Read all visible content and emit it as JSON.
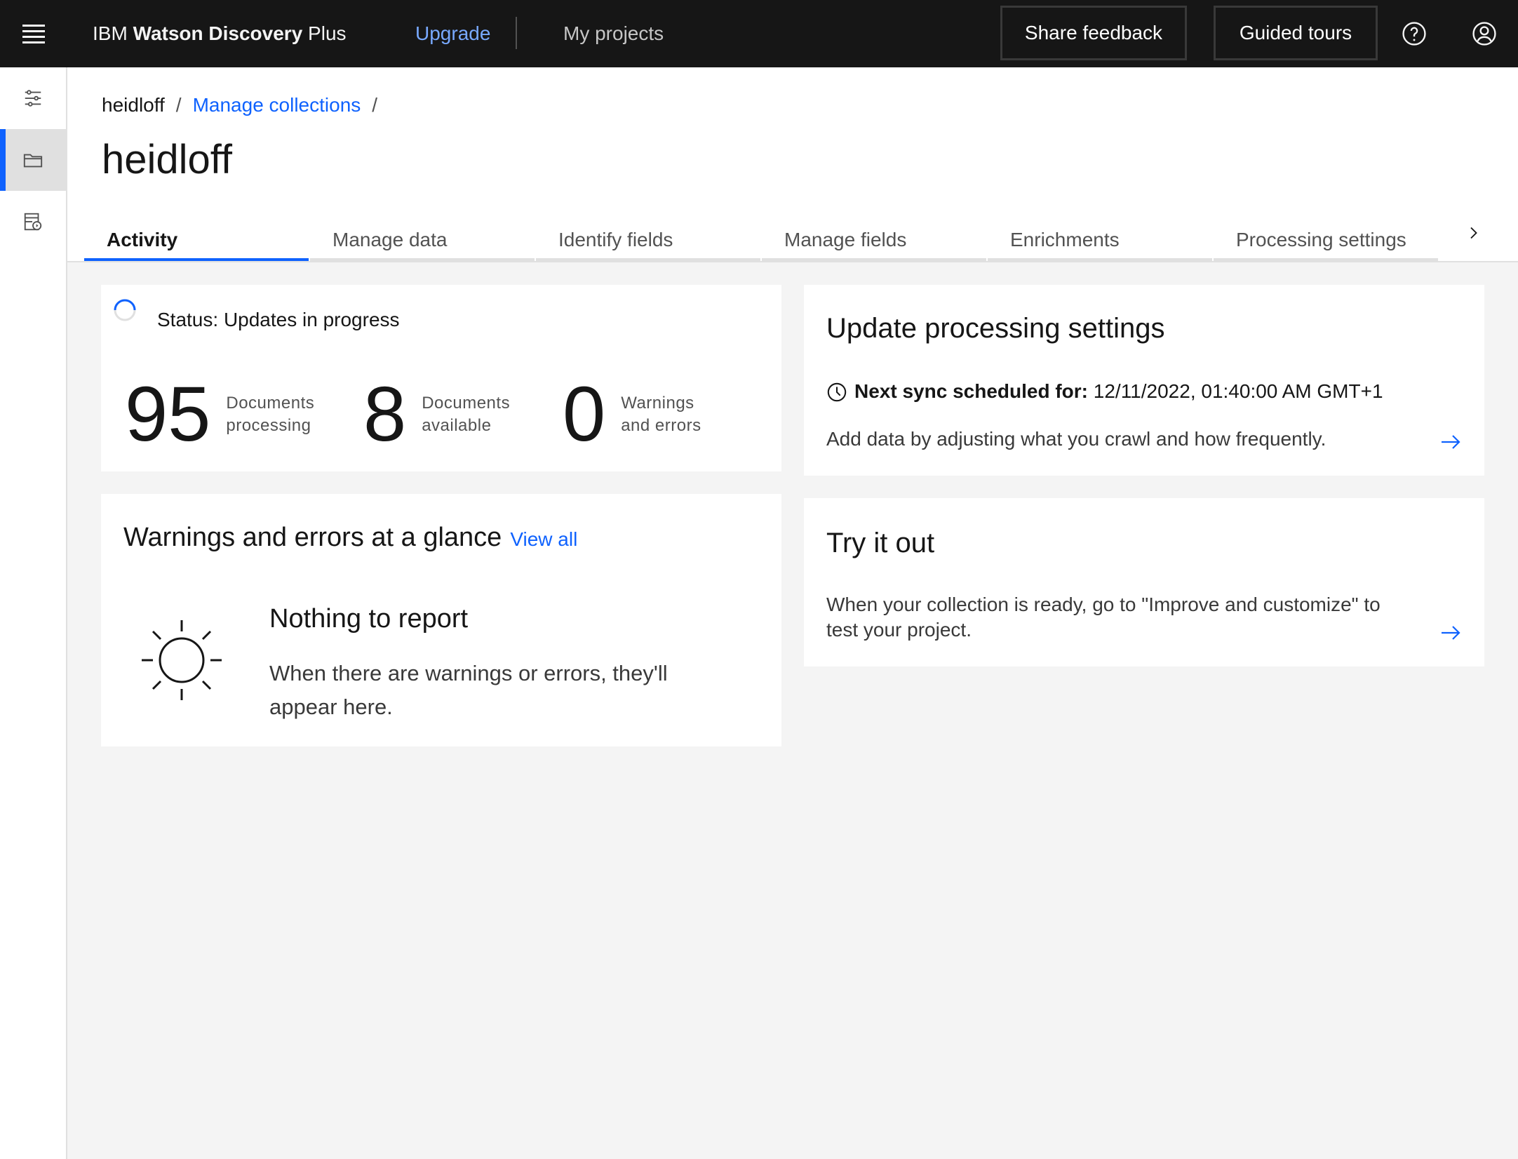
{
  "header": {
    "brand_prefix": "IBM ",
    "brand_bold": "Watson Discovery",
    "brand_suffix": " Plus",
    "upgrade": "Upgrade",
    "my_projects": "My projects",
    "share_feedback": "Share feedback",
    "guided_tours": "Guided tours",
    "icons": [
      "menu-icon",
      "help-icon",
      "user-avatar-icon"
    ]
  },
  "rail": {
    "items": [
      {
        "icon": "settings-adjust-icon",
        "active": false
      },
      {
        "icon": "folder-icon",
        "active": true
      },
      {
        "icon": "data-view-icon",
        "active": false
      }
    ]
  },
  "breadcrumb": {
    "items": [
      "heidloff",
      "Manage collections"
    ],
    "separator": "/"
  },
  "page_title": "heidloff",
  "tabs": [
    {
      "label": "Activity",
      "active": true
    },
    {
      "label": "Manage data",
      "active": false
    },
    {
      "label": "Identify fields",
      "active": false
    },
    {
      "label": "Manage fields",
      "active": false
    },
    {
      "label": "Enrichments",
      "active": false
    },
    {
      "label": "Processing settings",
      "active": false
    }
  ],
  "status": {
    "text": "Status: Updates in progress",
    "metrics": [
      {
        "value": "95",
        "label1": "Documents",
        "label2": "processing"
      },
      {
        "value": "8",
        "label1": "Documents",
        "label2": "available"
      },
      {
        "value": "0",
        "label1": "Warnings",
        "label2": "and errors"
      }
    ]
  },
  "warnings": {
    "title": "Warnings and errors at a glance",
    "view_all": "View all",
    "empty_title": "Nothing to report",
    "empty_body": "When there are warnings or errors, they'll appear here."
  },
  "update": {
    "title": "Update processing settings",
    "sync_label": "Next sync scheduled for:",
    "sync_value": " 12/11/2022, 01:40:00 AM GMT+1",
    "body": "Add data by adjusting what you crawl and how frequently."
  },
  "try_it": {
    "title": "Try it out",
    "body": "When your collection is ready, go to \"Improve and customize\" to test your project."
  },
  "colors": {
    "header_bg": "#161616",
    "accent": "#0f62fe",
    "upgrade_link": "#78a9ff",
    "page_bg": "#f4f4f4"
  }
}
